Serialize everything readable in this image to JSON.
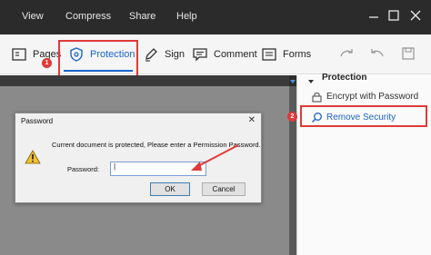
{
  "menubar": {
    "items": [
      "View",
      "Compress",
      "Share",
      "Help"
    ]
  },
  "toolbar": {
    "pages": "Pages",
    "protection": "Protection",
    "sign": "Sign",
    "comment": "Comment",
    "forms": "Forms"
  },
  "badges": {
    "one": "1",
    "two": "2"
  },
  "panel": {
    "heading": "Protection",
    "encrypt": "Encrypt with Password",
    "remove": "Remove Security"
  },
  "dialog": {
    "title": "Password",
    "close": "✕",
    "message": "Current document is protected, Please enter a Permission Password.",
    "label": "Password:",
    "input_value": "|",
    "ok": "OK",
    "cancel": "Cancel"
  },
  "colors": {
    "accent": "#1a64c8",
    "highlight": "#e03a3a",
    "menubar": "#2b2b2b"
  }
}
